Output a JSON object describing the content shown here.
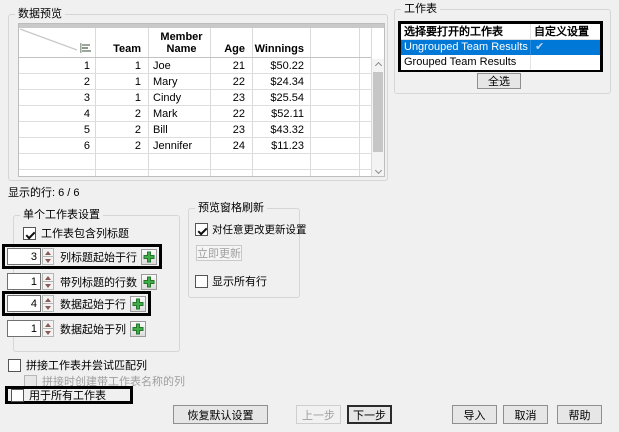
{
  "data_preview": {
    "group_label": "数据预览",
    "rows_shown": "显示的行: 6 / 6",
    "table": {
      "columns": [
        "Team",
        "Member Name",
        "Age",
        "Winnings"
      ],
      "rows": [
        {
          "num": "1",
          "team": "1",
          "name": "Joe",
          "age": "21",
          "winnings": "$50.22"
        },
        {
          "num": "2",
          "team": "1",
          "name": "Mary",
          "age": "22",
          "winnings": "$24.34"
        },
        {
          "num": "3",
          "team": "1",
          "name": "Cindy",
          "age": "23",
          "winnings": "$25.54"
        },
        {
          "num": "4",
          "team": "2",
          "name": "Mark",
          "age": "22",
          "winnings": "$52.11"
        },
        {
          "num": "5",
          "team": "2",
          "name": "Bill",
          "age": "23",
          "winnings": "$43.32"
        },
        {
          "num": "6",
          "team": "2",
          "name": "Jennifer",
          "age": "24",
          "winnings": "$11.23"
        }
      ]
    }
  },
  "worksheets": {
    "group_label": "工作表",
    "header_name": "选择要打开的工作表",
    "header_custom": "自定义设置",
    "items": [
      {
        "name": "Ungrouped Team Results",
        "custom_check": "✔"
      },
      {
        "name": "Grouped Team Results",
        "custom_check": ""
      }
    ],
    "select_all_label": "全选"
  },
  "sheet_settings": {
    "group_label": "单个工作表设置",
    "has_headers_label": "工作表包含列标题",
    "spinners": [
      {
        "value": "3",
        "label": "列标题起始于行"
      },
      {
        "value": "1",
        "label": "带列标题的行数"
      },
      {
        "value": "4",
        "label": "数据起始于行"
      },
      {
        "value": "1",
        "label": "数据起始于列"
      }
    ]
  },
  "preview_refresh": {
    "group_label": "预览窗格刷新",
    "auto_update_label": "对任意更改更新设置",
    "update_now_label": "立即更新",
    "show_all_rows_label": "显示所有行"
  },
  "concat": {
    "concat_label": "拼接工作表并尝试匹配列",
    "create_col_label": "拼接时创建带工作表名称的列",
    "all_sheets_label": "用于所有工作表"
  },
  "footer": {
    "restore_label": "恢复默认设置",
    "prev_label": "上一步",
    "next_label": "下一步",
    "import_label": "导入",
    "cancel_label": "取消",
    "help_label": "帮助"
  },
  "colors": {
    "selection_blue": "#0078d7",
    "plus_green": "#3fae49",
    "highlight_black": "#000000"
  }
}
